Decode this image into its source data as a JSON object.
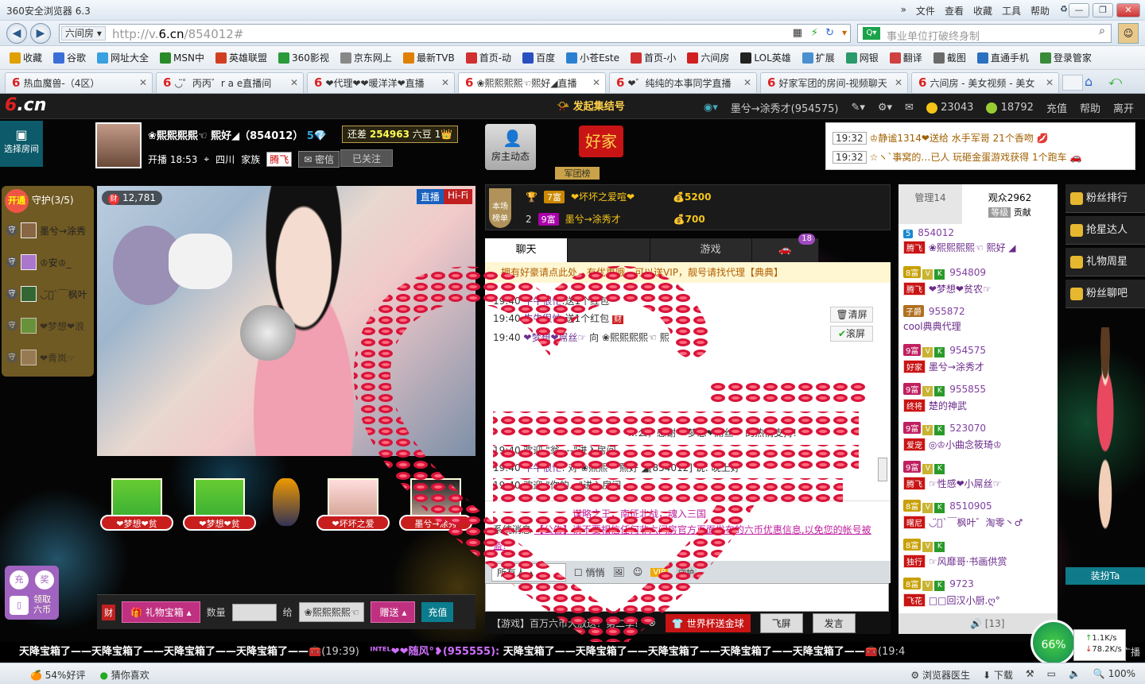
{
  "browser": {
    "title": "360安全浏览器 6.3",
    "menu": [
      "文件",
      "查看",
      "收藏",
      "工具",
      "帮助"
    ],
    "url_tag": "六间房",
    "url_prefix": "http://v.",
    "url_domain": "6.cn",
    "url_path": "/854012#",
    "search_placeholder": "事业单位打破终身制",
    "favorites": [
      {
        "label": "收藏",
        "color": "#e0a000"
      },
      {
        "label": "谷歌",
        "color": "#3a6fd8"
      },
      {
        "label": "网址大全",
        "color": "#3aa0e0"
      },
      {
        "label": "MSN中",
        "color": "#2a8a2a"
      },
      {
        "label": "英雄联盟",
        "color": "#d04020"
      },
      {
        "label": "360影视",
        "color": "#2a9a3a"
      },
      {
        "label": "京东网上",
        "color": "#888888"
      },
      {
        "label": "最新TVB",
        "color": "#e08000"
      },
      {
        "label": "首页-动",
        "color": "#d03030"
      },
      {
        "label": "百度",
        "color": "#2a50c0"
      },
      {
        "label": "小苍Este",
        "color": "#2a80d0"
      },
      {
        "label": "首页-小",
        "color": "#d03030"
      },
      {
        "label": "六间房",
        "color": "#d02020"
      },
      {
        "label": "LOL英雄",
        "color": "#222222"
      },
      {
        "label": "扩展",
        "color": "#4a90d0"
      },
      {
        "label": "网银",
        "color": "#2a9a6a"
      },
      {
        "label": "翻译",
        "color": "#d04040"
      },
      {
        "label": "截图",
        "color": "#6a6a6a"
      },
      {
        "label": "直通手机",
        "color": "#2a70c0"
      },
      {
        "label": "登录管家",
        "color": "#3a8a3a"
      }
    ],
    "tabs": [
      {
        "label": "热血魔兽-（4区）",
        "active": false
      },
      {
        "label": "◡̈゜丙丙゛r a e直播间",
        "active": false
      },
      {
        "label": "❤代理❤❤暖洋洋❤直播",
        "active": false
      },
      {
        "label": "❀熙熙熙熙☜熙好◢直播",
        "active": true
      },
      {
        "label": "❤゛纯纯的本事同学直播",
        "active": false
      },
      {
        "label": "好家军团的房间-视频聊天",
        "active": false
      },
      {
        "label": "六间房 - 美女视频 - 美女",
        "active": false
      }
    ]
  },
  "site": {
    "logo": "6.cn",
    "rally_label": "发起集结号",
    "user_display": "墨兮→涂秀才(954575)",
    "coins": "23043",
    "beans": "18792",
    "nav_links": [
      "充值",
      "帮助",
      "离开"
    ],
    "choose_room": "选择房间",
    "host_name": "❀熙熙熙熙☜ 熙好◢（854012）",
    "host_level": "5",
    "bean_gap_label": "还差",
    "bean_gap_value": "254963",
    "bean_gap_unit": "六豆 1",
    "start_time": "开播 18:53",
    "location": "四川",
    "family_label": "家族",
    "family_badge": "腾飞",
    "private_msg": "密信",
    "follow_label": "已关注",
    "host_dynamic": "房主动态",
    "haojia": "好家",
    "juntuan": "军团榜",
    "notices": [
      {
        "time": "19:32",
        "text": "♔静谧1314❤送给 水手军哥 21个香吻"
      },
      {
        "time": "19:32",
        "text": "☆ヽ`事窝的…已人 玩砸金蛋游戏获得 1个跑车"
      }
    ]
  },
  "guard": {
    "open_label": "开通",
    "title": "守护(3/5)",
    "members": [
      "墨兮→涂秀",
      "♔安♔_",
      "◡̈⃝`￣枫叶",
      "❤梦想❤浪",
      "❤青岚☞"
    ]
  },
  "video": {
    "fire_count": "12,781",
    "live_label": "直播",
    "quality_label": "Hi-Fi"
  },
  "gifts": [
    "❤梦想❤贫",
    "❤梦想❤贫",
    "",
    "❤坏坏之爱",
    "墨兮→涂秀"
  ],
  "giftbar": {
    "gift_box": "礼物宝箱",
    "qty_label": "数量",
    "give_label": "给",
    "target": "❀熙熙熙熙☜",
    "send": "赠送",
    "charge": "充值"
  },
  "sidemini": {
    "charge": "充",
    "prize": "奖",
    "claim": "领取六币"
  },
  "board": {
    "tag": "本场榜单",
    "rows": [
      {
        "rank": "1",
        "level": "7富",
        "name": "❤坏坏之爱喧❤",
        "value": "5200"
      },
      {
        "rank": "2",
        "level": "9富",
        "name": "墨兮→涂秀才",
        "value": "700"
      }
    ]
  },
  "chat": {
    "tabs": [
      "聊天",
      "",
      "",
      "游戏",
      ""
    ],
    "car_count": "18",
    "top_note": "拥有好豪请点此处，有优惠哦，可以送VIP，靓号请找代理【典典】",
    "clear_btn": "清屏",
    "scroll_btn": "滚屏",
    "lines": [
      {
        "time": "19:40",
        "name": "牛牛很忙",
        "text": ":送1个红包"
      },
      {
        "time": "19:40",
        "name": "牛牛很忙",
        "text": ":送1个红包"
      },
      {
        "time": "19:40",
        "name": "❤梦想❤屌丝☞",
        "text": "向 ❀熙熙熙熙☜ 熙"
      },
      {
        "time": "",
        "name": "",
        "text": "…么，感谢 ☜梦想❤屌丝☞ 的热情支持!"
      },
      {
        "time": "19:40",
        "name": "",
        "text": "欢迎 \"翁----\"进入房间"
      },
      {
        "time": "19:40",
        "name": "牛牛很忙",
        "text": ": 对 ❀熙熙☜ 熙好 ◢[854012] 说: 晚上好"
      },
      {
        "time": "19:40",
        "name": "",
        "text": "欢迎 \"你的…\"进入房间"
      }
    ],
    "sys_line1": "谋略之王，南征北战，魂入三国",
    "sys_label": "系统消息",
    "sys_line2": "【公告】请不要相信任何非六间房官方页面发布的六币优惠信息,以免您的帐号被盗!",
    "to_all": "所有人",
    "whisper": "悄悄",
    "vip": "VIP",
    "guard_icon": "守护",
    "promo": "【游戏】百万六币大放送！第二季!",
    "worldcup": "世界杯送金球",
    "fly": "飞屏",
    "say": "发言"
  },
  "audience": {
    "admin_tab": "管理14",
    "viewers_tab": "观众2962",
    "level_tab": "等级",
    "contrib_tab": "贡献",
    "users": [
      {
        "level": "5",
        "id": "854012",
        "badge": "腾飞",
        "name": "❀熙熙熙熙☜ 熙好 ◢"
      },
      {
        "level": "8富",
        "id": "954809",
        "badge": "腾飞",
        "name": "❤梦想❤贫农☞"
      },
      {
        "level": "子爵",
        "id": "955872",
        "badge": "",
        "name": "cool典典代理"
      },
      {
        "level": "9富",
        "id": "954575",
        "badge": "好家",
        "name": "墨兮→涂秀才"
      },
      {
        "level": "9富",
        "id": "955855",
        "badge": "终将",
        "name": "楚的神武"
      },
      {
        "level": "9富",
        "id": "523070",
        "badge": "爱宠",
        "name": "◎♔小曲念筱琦♔"
      },
      {
        "level": "9富",
        "id": "",
        "badge": "腾飞",
        "name": "☞性感❤小屌丝☞"
      },
      {
        "level": "8富",
        "id": "8510905",
        "badge": "曙尼",
        "name": "◡̈⃝`￣枫叶゛淘零丶♂"
      },
      {
        "level": "8富",
        "id": "",
        "badge": "独行",
        "name": "☞风靡哥·书画供赏"
      },
      {
        "level": "8富",
        "id": "9723",
        "badge": "飞花",
        "name": "□□回汉小厨.ღ°"
      }
    ],
    "footer": "[13]"
  },
  "right_menu": [
    "粉丝排行",
    "抢星达人",
    "礼物周星",
    "粉丝聊吧"
  ],
  "dress_btn": "装扮Ta",
  "ticker": {
    "text1": "天降宝箱了——天降宝箱了——天降宝箱了——天降宝箱了——",
    "time1": "(19:39)",
    "user": "ᴵᴺᵀᴱᴸ❤❤随风°❥(955555):",
    "text2": "天降宝箱了——天降宝箱了——天降宝箱了——天降宝箱了——天降宝箱了——",
    "time2": "(19:4",
    "broadcast": "广播"
  },
  "speed": {
    "percent": "66%",
    "up": "1.1K/s",
    "down": "78.2K/s"
  },
  "status": {
    "rating": "54%好评",
    "guess": "猜你喜欢",
    "doctor": "浏览器医生",
    "download": "下载",
    "zoom": "100%"
  }
}
